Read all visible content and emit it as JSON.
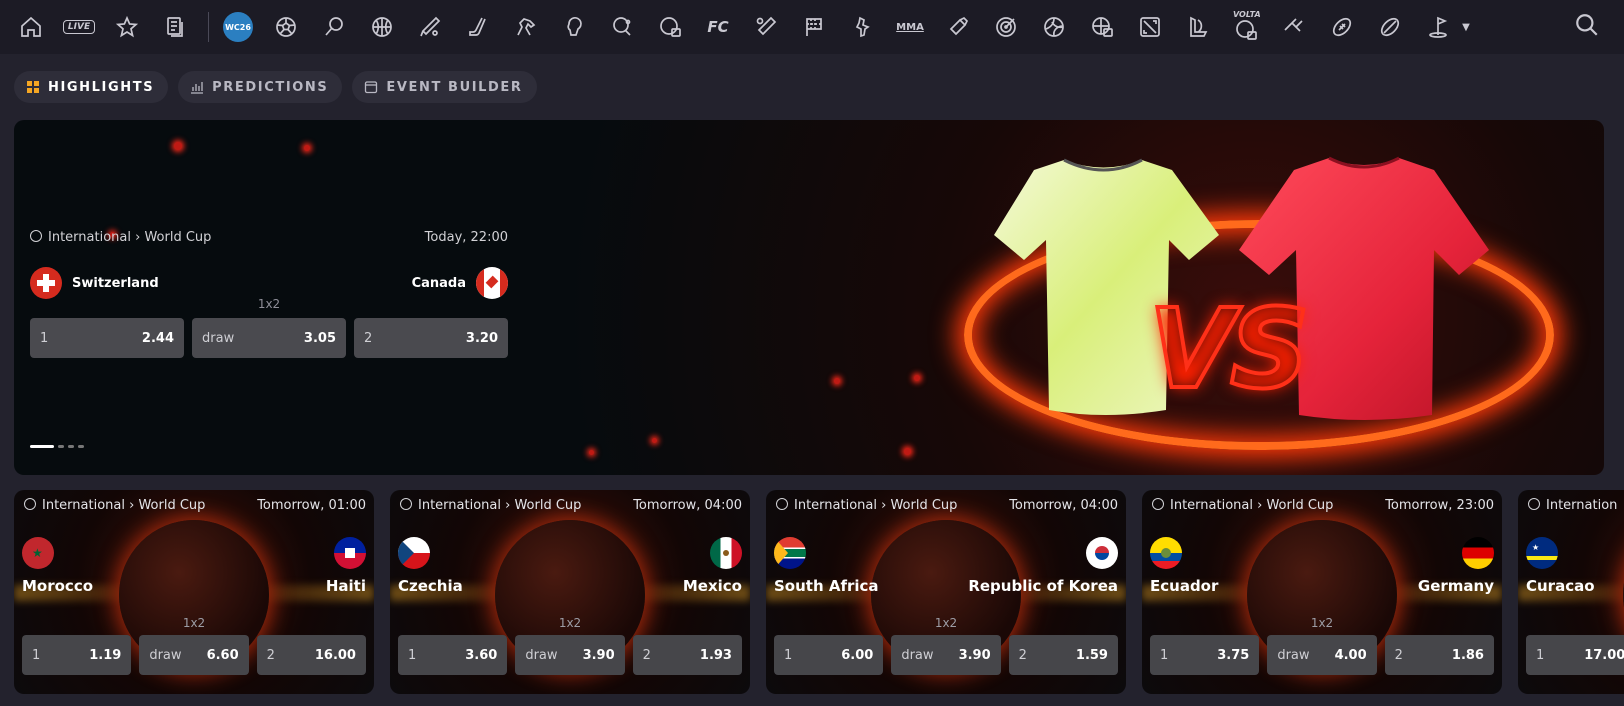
{
  "topnav": {
    "live_label": "LIVE",
    "fc_label": "FC",
    "mma_label": "MMA",
    "volta_label": "VOLTA",
    "wc_label": "WC26"
  },
  "tabs": [
    {
      "label": "HIGHLIGHTS",
      "icon": "grid-icon",
      "active": true
    },
    {
      "label": "PREDICTIONS",
      "icon": "chart-icon",
      "active": false
    },
    {
      "label": "EVENT BUILDER",
      "icon": "calendar-icon",
      "active": false
    }
  ],
  "hero": {
    "region": "International",
    "league": "World Cup",
    "time": "Today, 22:00",
    "home": "Switzerland",
    "away": "Canada",
    "market": "1x2",
    "odds": [
      {
        "label": "1",
        "value": "2.44"
      },
      {
        "label": "draw",
        "value": "3.05"
      },
      {
        "label": "2",
        "value": "3.20"
      }
    ],
    "slide_count": 4,
    "active_slide": 1
  },
  "cards": [
    {
      "region": "International",
      "league": "World Cup",
      "time": "Tomorrow, 01:00",
      "home": "Morocco",
      "away": "Haiti",
      "market": "1x2",
      "odds": [
        {
          "label": "1",
          "value": "1.19"
        },
        {
          "label": "draw",
          "value": "6.60"
        },
        {
          "label": "2",
          "value": "16.00"
        }
      ]
    },
    {
      "region": "International",
      "league": "World Cup",
      "time": "Tomorrow, 04:00",
      "home": "Czechia",
      "away": "Mexico",
      "market": "1x2",
      "odds": [
        {
          "label": "1",
          "value": "3.60"
        },
        {
          "label": "draw",
          "value": "3.90"
        },
        {
          "label": "2",
          "value": "1.93"
        }
      ]
    },
    {
      "region": "International",
      "league": "World Cup",
      "time": "Tomorrow, 04:00",
      "home": "South Africa",
      "away": "Republic of Korea",
      "market": "1x2",
      "odds": [
        {
          "label": "1",
          "value": "6.00"
        },
        {
          "label": "draw",
          "value": "3.90"
        },
        {
          "label": "2",
          "value": "1.59"
        }
      ]
    },
    {
      "region": "International",
      "league": "World Cup",
      "time": "Tomorrow, 23:00",
      "home": "Ecuador",
      "away": "Germany",
      "market": "1x2",
      "odds": [
        {
          "label": "1",
          "value": "3.75"
        },
        {
          "label": "draw",
          "value": "4.00"
        },
        {
          "label": "2",
          "value": "1.86"
        }
      ]
    },
    {
      "region": "Internation",
      "league": "",
      "time": "",
      "home": "Curacao",
      "away": "",
      "market": "",
      "odds": [
        {
          "label": "1",
          "value": "17.00"
        },
        {
          "label": "",
          "value": ""
        },
        {
          "label": "",
          "value": ""
        }
      ]
    }
  ],
  "colors": {
    "accent": "#f5a623",
    "background": "#23222d",
    "topbar": "#1c1b25"
  }
}
